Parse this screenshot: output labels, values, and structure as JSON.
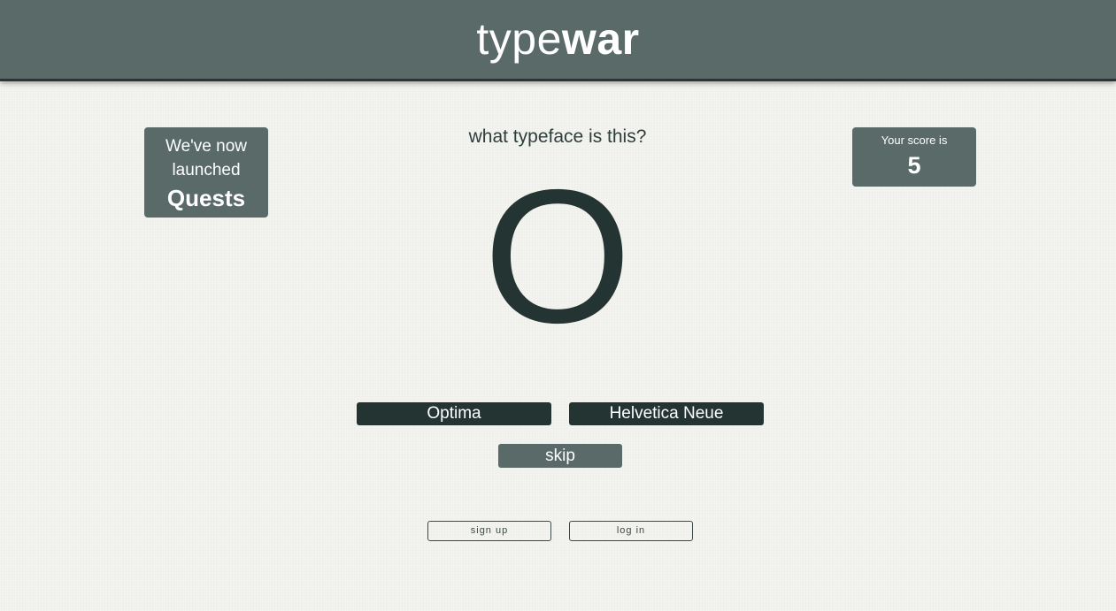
{
  "header": {
    "logo_light": "type",
    "logo_bold": "war"
  },
  "quests_badge": {
    "line1": "We've now",
    "line2": "launched",
    "line3": "Quests"
  },
  "score": {
    "label": "Your score is",
    "value": "5"
  },
  "quiz": {
    "question": "what typeface is this?",
    "glyph": "O",
    "options": [
      "Optima",
      "Helvetica Neue"
    ],
    "skip_label": "skip"
  },
  "auth": {
    "signup_label": "sign up",
    "login_label": "log in"
  },
  "colors": {
    "header_bg": "#596a68",
    "page_bg": "#f3f3ef",
    "dark_button": "#243433",
    "muted_button": "#596a68",
    "text": "#243433"
  }
}
